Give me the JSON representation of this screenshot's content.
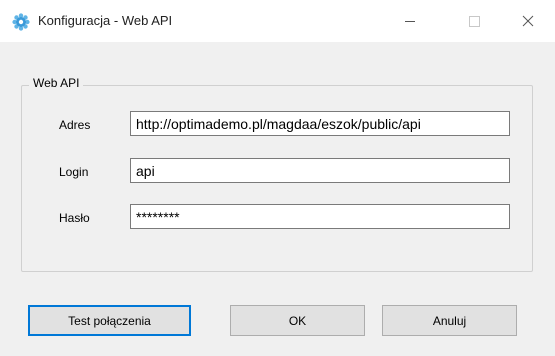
{
  "window": {
    "title": "Konfiguracja - Web API",
    "icon": "gear-icon",
    "controls": [
      "minimize-icon",
      "maximize-icon",
      "close-icon"
    ],
    "accent_color": "#0078d7"
  },
  "group": {
    "legend": "Web API",
    "fields": {
      "address": {
        "label": "Adres",
        "value": "http://optimademo.pl/magdaa/eszok/public/api"
      },
      "login": {
        "label": "Login",
        "value": "api"
      },
      "password": {
        "label": "Hasło",
        "value": "********"
      }
    }
  },
  "buttons": {
    "test": "Test połączenia",
    "ok": "OK",
    "cancel": "Anuluj"
  }
}
